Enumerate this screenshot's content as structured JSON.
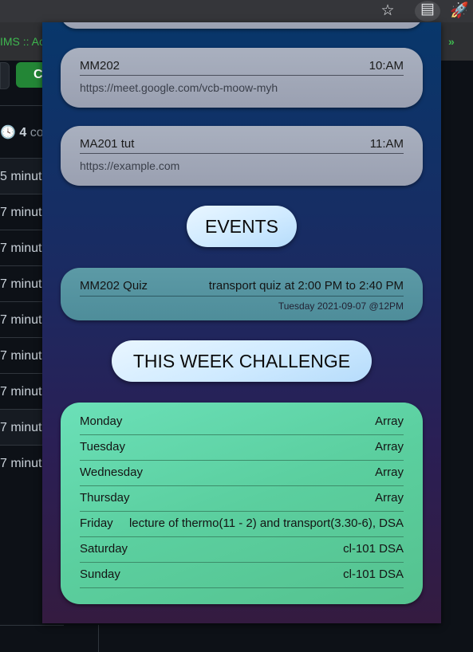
{
  "browser": {
    "bookmark_text": "IMS :: Ac",
    "bookmark_more": "»"
  },
  "background_page": {
    "button_letter": "C",
    "commits_count": "4",
    "commits_label": "co",
    "rows": [
      "5 minut",
      "7 minut",
      "7 minut",
      "7 minut",
      "7 minut",
      "7 minut",
      "7 minut",
      "7 minut",
      "7 minut"
    ]
  },
  "meetings": [
    {
      "name": "MM202",
      "time": "10:AM",
      "link": "https://meet.google.com/vcb-moow-myh"
    },
    {
      "name": "MA201 tut",
      "time": "11:AM",
      "link": "https://example.com"
    }
  ],
  "events_heading": "EVENTS",
  "events": [
    {
      "name": "MM202 Quiz",
      "description": "transport quiz at 2:00 PM to 2:40 PM",
      "date": "Tuesday 2021-09-07 @12PM"
    }
  ],
  "challenge_heading": "THIS WEEK CHALLENGE",
  "week": [
    {
      "day": "Monday",
      "task": "Array"
    },
    {
      "day": "Tuesday",
      "task": "Array"
    },
    {
      "day": "Wednesday",
      "task": "Array"
    },
    {
      "day": "Thursday",
      "task": "Array"
    },
    {
      "day": "Friday",
      "task": "lecture of thermo(11 - 2) and transport(3.30-6), DSA"
    },
    {
      "day": "Saturday",
      "task": "cl-101 DSA"
    },
    {
      "day": "Sunday",
      "task": "cl-101 DSA"
    }
  ],
  "colors": {
    "accent_green": "#3fb950",
    "meeting_card": "#a9b0bf",
    "event_card": "#5c9aa6",
    "week_card": "#5bcf9f"
  }
}
